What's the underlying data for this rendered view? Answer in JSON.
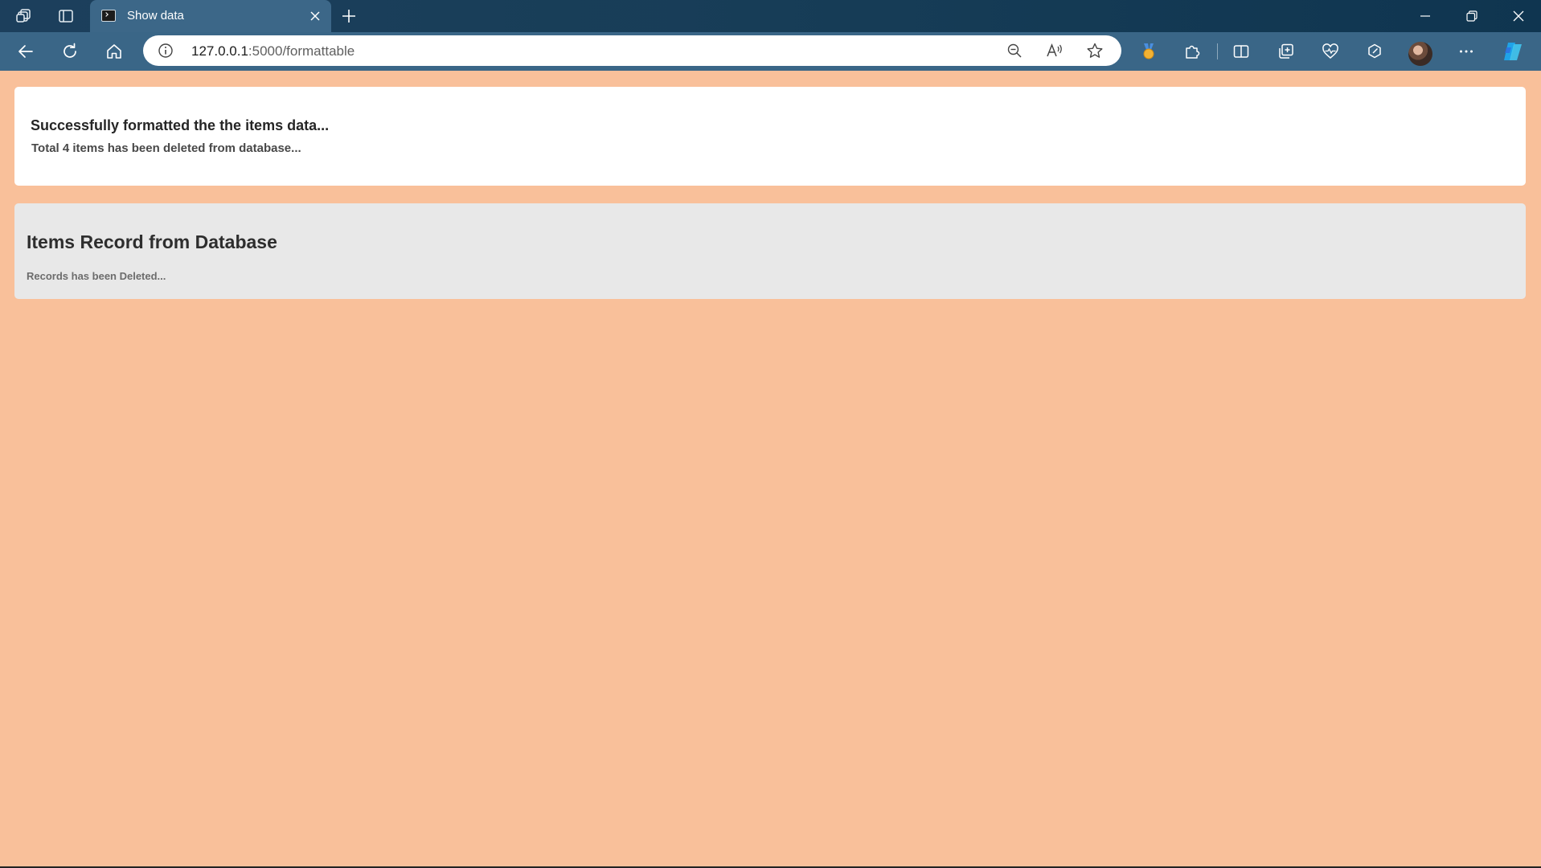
{
  "browser": {
    "tab": {
      "title": "Show data",
      "favicon": "terminal-icon"
    },
    "address": {
      "host": "127.0.0.1",
      "path": ":5000/formattable"
    },
    "colors": {
      "titlebar": "#173d57",
      "toolbar": "#3a6687",
      "active_tab": "#3c6788"
    }
  },
  "page": {
    "background": "#f9c09a",
    "success": {
      "heading": "Successfully formatted the the items data...",
      "detail": "Total 4 items has been deleted from database..."
    },
    "records": {
      "heading": "Items Record from Database",
      "status": "Records has been Deleted..."
    }
  }
}
